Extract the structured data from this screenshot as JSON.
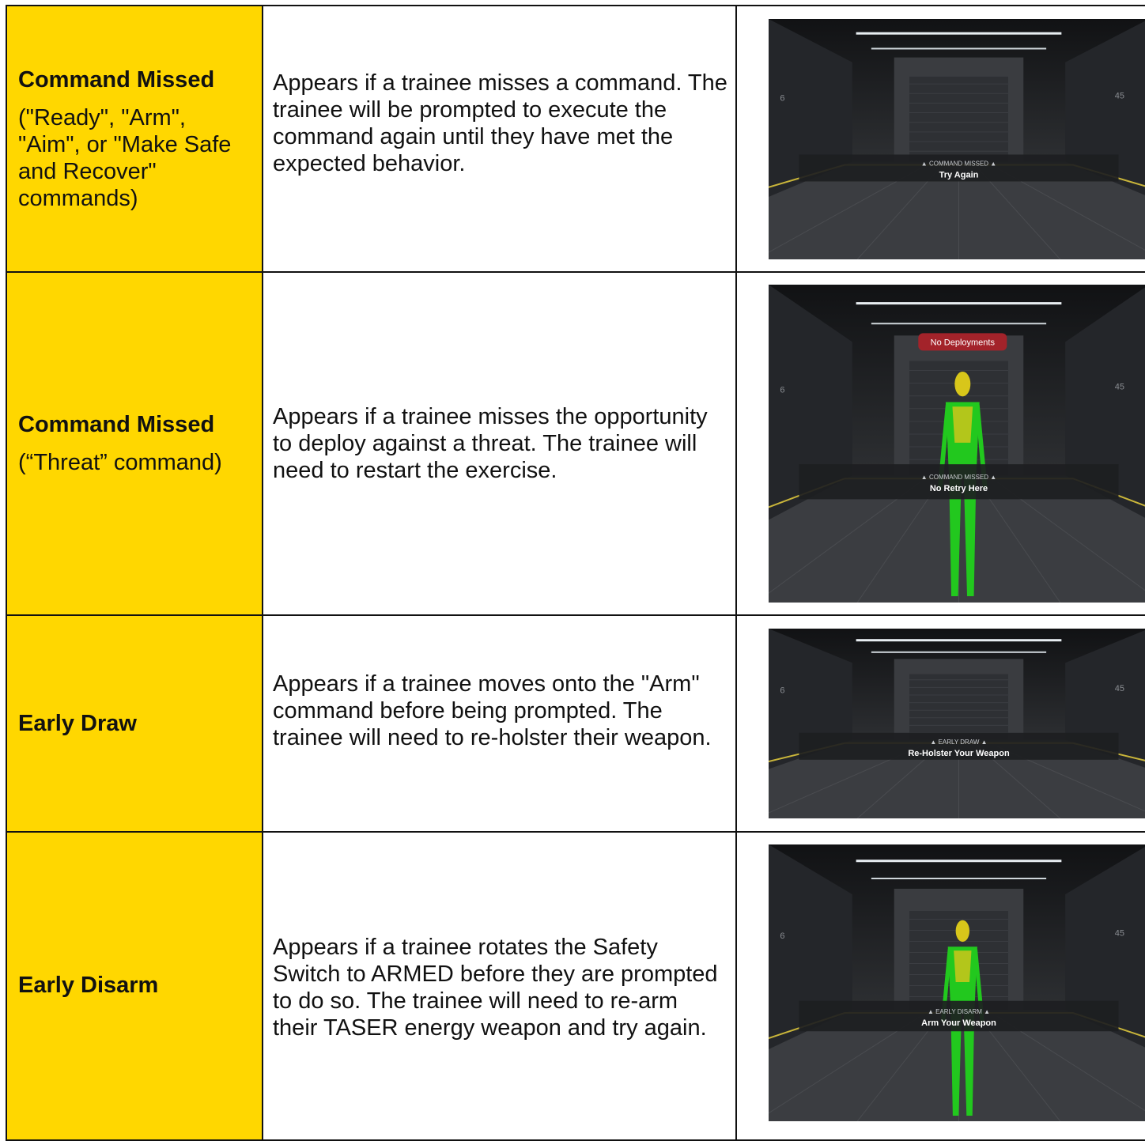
{
  "rows": [
    {
      "title": "Command Missed",
      "subtitle": "(\"Ready\", \"Arm\", \"Aim\", or \"Make Safe and Recover\" commands)",
      "description": "Appears if a trainee misses a command. The trainee will be prompted to execute the command again until they have met the expected behavior.",
      "screenshot": {
        "banner_title": "COMMAND MISSED",
        "banner_message": "Try Again",
        "wall_number_right": "45",
        "wall_number_left": "6",
        "figure": false,
        "badge": ""
      }
    },
    {
      "title": "Command Missed",
      "subtitle": "(“Threat” command)",
      "description": "Appears if a trainee misses the opportunity to deploy against a threat. The trainee will need to restart the exercise.",
      "screenshot": {
        "banner_title": "COMMAND MISSED",
        "banner_message": "No Retry Here",
        "wall_number_right": "45",
        "wall_number_left": "6",
        "figure": true,
        "badge": "No Deployments"
      }
    },
    {
      "title": "Early Draw",
      "subtitle": "",
      "description": "Appears if a trainee moves onto the \"Arm\" command before being prompted. The trainee will need to re-holster their weapon.",
      "screenshot": {
        "banner_title": "EARLY DRAW",
        "banner_message": "Re-Holster Your Weapon",
        "wall_number_right": "45",
        "wall_number_left": "6",
        "figure": false,
        "badge": ""
      }
    },
    {
      "title": "Early Disarm",
      "subtitle": "",
      "description": "Appears if a trainee rotates the Safety Switch to ARMED before they are prompted to do so. The trainee will need to re-arm their TASER energy weapon and try again.",
      "screenshot": {
        "banner_title": "EARLY DISARM",
        "banner_message": "Arm Your Weapon",
        "wall_number_right": "45",
        "wall_number_left": "6",
        "figure": true,
        "badge": ""
      }
    }
  ],
  "colors": {
    "label_bg": "#FFD700",
    "border": "#111111",
    "scene_bg": "#1c1d1f",
    "floor_line": "#c9b53a",
    "figure": "#22c81e",
    "figure_head": "#d8c61a",
    "badge": "#a3232a"
  },
  "icons": {
    "warning": "warning-triangle-icon"
  }
}
